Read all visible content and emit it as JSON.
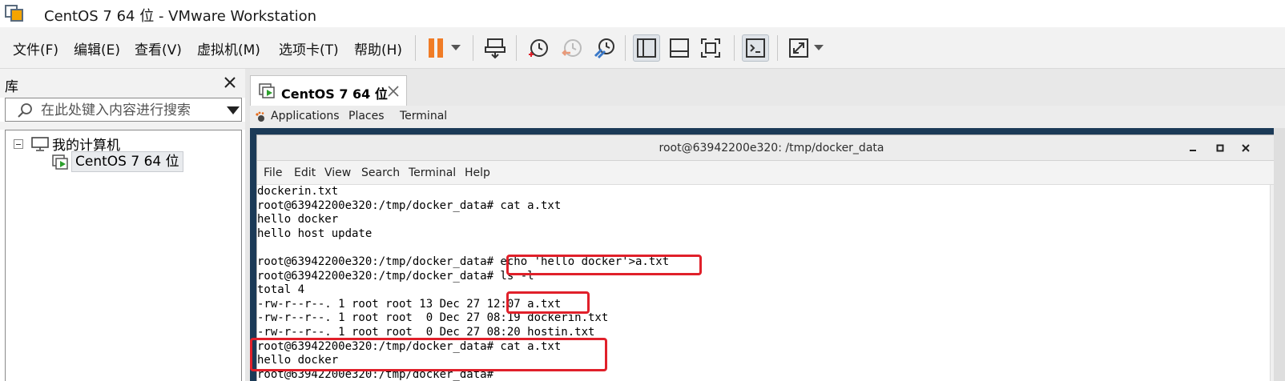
{
  "window": {
    "title": "CentOS 7 64 位 - VMware Workstation"
  },
  "menu": {
    "items": [
      "文件(F)",
      "编辑(E)",
      "查看(V)",
      "虚拟机(M)",
      "选项卡(T)",
      "帮助(H)"
    ]
  },
  "toolbar": {
    "icons": [
      "pause-icon",
      "dropdown-arrow-icon",
      "send-keys-icon",
      "snapshot-icon",
      "revert-snapshot-icon",
      "snapshot-manager-icon",
      "library-view-icon",
      "thumbnail-view-icon",
      "fullscreen-icon",
      "console-view-icon",
      "stretch-icon",
      "dropdown-arrow-icon"
    ],
    "colors": {
      "pause": "#f07c26",
      "snapshot": "#3a78c8",
      "revert": "#e89a7a"
    }
  },
  "library": {
    "title": "库",
    "search_placeholder": "在此处键入内容进行搜索",
    "tree": {
      "root_label": "我的计算机",
      "child_label": "CentOS 7 64 位"
    }
  },
  "tab": {
    "label": "CentOS 7 64 位"
  },
  "guest_topbar": {
    "applications": "Applications",
    "places": "Places",
    "terminal": "Terminal"
  },
  "terminal": {
    "title": "root@63942200e320: /tmp/docker_data",
    "menu": [
      "File",
      "Edit",
      "View",
      "Search",
      "Terminal",
      "Help"
    ],
    "lines": [
      "dockerin.txt",
      "root@63942200e320:/tmp/docker_data# cat a.txt",
      "hello docker",
      "hello host update",
      "",
      "root@63942200e320:/tmp/docker_data# echo 'hello docker'>a.txt",
      "root@63942200e320:/tmp/docker_data# ls -l",
      "total 4",
      "-rw-r--r--. 1 root root 13 Dec 27 12:07 a.txt",
      "-rw-r--r--. 1 root root  0 Dec 27 08:19 dockerin.txt",
      "-rw-r--r--. 1 root root  0 Dec 27 08:20 hostin.txt",
      "root@63942200e320:/tmp/docker_data# cat a.txt",
      "hello docker",
      "root@63942200e320:/tmp/docker_data# "
    ],
    "annotation_color": "#e0202a"
  }
}
